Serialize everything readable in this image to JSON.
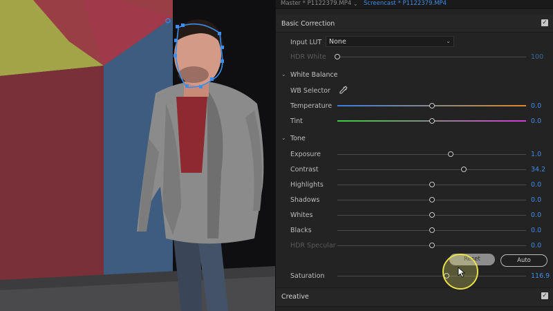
{
  "tabs": {
    "master": "Master * P1122379.MP4",
    "screencast": "Screencast * P1122379.MP4"
  },
  "basic_correction": {
    "title": "Basic Correction",
    "enabled": true,
    "input_lut_label": "Input LUT",
    "input_lut_value": "None",
    "hdr_white": {
      "label": "HDR White",
      "value": "100",
      "level": 0.0
    }
  },
  "white_balance": {
    "title": "White Balance",
    "wb_selector_label": "WB Selector",
    "temperature": {
      "label": "Temperature",
      "value": "0.0",
      "level": 0.5
    },
    "tint": {
      "label": "Tint",
      "value": "0.0",
      "level": 0.5
    }
  },
  "tone": {
    "title": "Tone",
    "sliders": [
      {
        "label": "Exposure",
        "value": "1.0",
        "level": 0.6
      },
      {
        "label": "Contrast",
        "value": "34.2",
        "level": 0.67
      },
      {
        "label": "Highlights",
        "value": "0.0",
        "level": 0.5
      },
      {
        "label": "Shadows",
        "value": "0.0",
        "level": 0.5
      },
      {
        "label": "Whites",
        "value": "0.0",
        "level": 0.5
      },
      {
        "label": "Blacks",
        "value": "0.0",
        "level": 0.5
      },
      {
        "label": "HDR Specular",
        "value": "0.0",
        "level": 0.5
      }
    ],
    "reset_label": "Reset",
    "auto_label": "Auto"
  },
  "saturation": {
    "label": "Saturation",
    "value": "116.9",
    "level": 0.58
  },
  "creative": {
    "title": "Creative",
    "enabled": true
  },
  "colors": {
    "accent": "#3e8de6",
    "temp_left": "#3a7ee0",
    "temp_right": "#e0892c",
    "tint_left": "#3fcf3f",
    "tint_right": "#d23bd6",
    "mask": "#3a8ff0",
    "cursor_highlight": "#f6f36e"
  }
}
